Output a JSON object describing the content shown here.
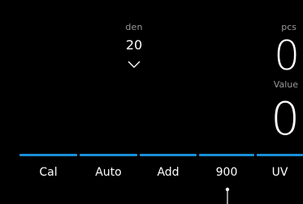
{
  "denomination": {
    "label": "den",
    "value": "20",
    "icon": "chevron-down-icon"
  },
  "counters": {
    "pcs_label": "pcs",
    "pcs_value": "0",
    "value_label": "Value",
    "value_value": "0"
  },
  "softkeys": [
    {
      "label": "Cal"
    },
    {
      "label": "Auto"
    },
    {
      "label": "Add"
    },
    {
      "label": "900"
    },
    {
      "label": "UV"
    }
  ],
  "colors": {
    "background": "#000000",
    "accent": "#1a8fd8",
    "text": "#ffffff",
    "muted": "#9a9a9a"
  }
}
